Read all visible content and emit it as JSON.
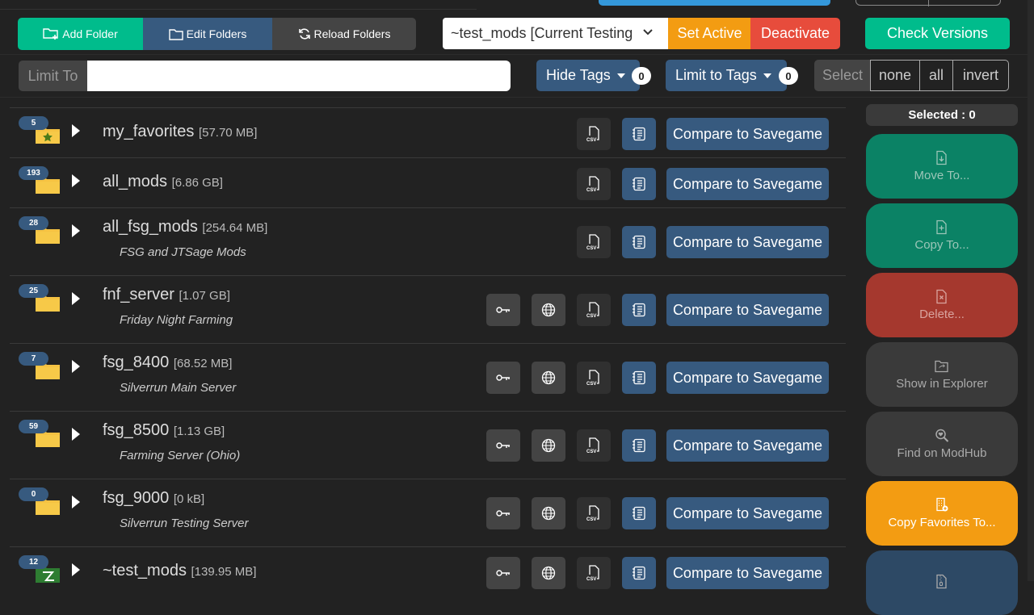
{
  "toolbar": {
    "add_folder": "Add Folder",
    "edit_folders": "Edit Folders",
    "reload_folders": "Reload Folders",
    "active_folder_select": "~test_mods [Current Testing",
    "set_active": "Set Active",
    "deactivate": "Deactivate",
    "check_versions": "Check Versions"
  },
  "filter": {
    "limit_to_label": "Limit To",
    "limit_to_value": "",
    "limit_to_placeholder": "",
    "hide_tags": "Hide Tags",
    "hide_tags_count": "0",
    "limit_to_tags": "Limit to Tags",
    "limit_to_tags_count": "0",
    "select_label": "Select",
    "select_none": "none",
    "select_all": "all",
    "select_invert": "invert"
  },
  "colors": {
    "success": "#00bc8c",
    "primary": "#375a7f",
    "warning": "#f39c12",
    "danger": "#e74c3c",
    "info": "#3498db",
    "folder": "#f5c242"
  },
  "compare_label": "Compare to Savegame",
  "folders": [
    {
      "count": "5",
      "name": "my_favorites",
      "size": "[57.70 MB]",
      "desc": "",
      "icon": "folder-star-icon",
      "server": false
    },
    {
      "count": "193",
      "name": "all_mods",
      "size": "[6.86 GB]",
      "desc": "",
      "icon": "folder-icon",
      "server": false
    },
    {
      "count": "28",
      "name": "all_fsg_mods",
      "size": "[254.64 MB]",
      "desc": "FSG and JTSage Mods",
      "icon": "folder-icon",
      "server": false
    },
    {
      "count": "25",
      "name": "fnf_server",
      "size": "[1.07 GB]",
      "desc": "Friday Night Farming",
      "icon": "folder-icon",
      "server": true
    },
    {
      "count": "7",
      "name": "fsg_8400",
      "size": "[68.52 MB]",
      "desc": "Silverrun Main Server",
      "icon": "folder-icon",
      "server": true
    },
    {
      "count": "59",
      "name": "fsg_8500",
      "size": "[1.13 GB]",
      "desc": "Farming Server (Ohio)",
      "icon": "folder-icon",
      "server": true
    },
    {
      "count": "0",
      "name": "fsg_9000",
      "size": "[0 kB]",
      "desc": "Silverrun Testing Server",
      "icon": "folder-icon",
      "server": true
    },
    {
      "count": "12",
      "name": "~test_mods",
      "size": "[139.95 MB]",
      "desc": "",
      "icon": "folder-active-icon",
      "server": true
    }
  ],
  "sidebar": {
    "selected_label": "Selected : 0",
    "actions": [
      {
        "label": "Move To...",
        "icon": "file-move-icon"
      },
      {
        "label": "Copy To...",
        "icon": "file-copy-icon"
      },
      {
        "label": "Delete...",
        "icon": "file-delete-icon"
      },
      {
        "label": "Show in Explorer",
        "icon": "folder-open-icon"
      },
      {
        "label": "Find on ModHub",
        "icon": "search-heart-icon"
      },
      {
        "label": "Copy Favorites To...",
        "icon": "building-add-icon"
      },
      {
        "label": "",
        "icon": "file-zip-icon"
      }
    ]
  }
}
